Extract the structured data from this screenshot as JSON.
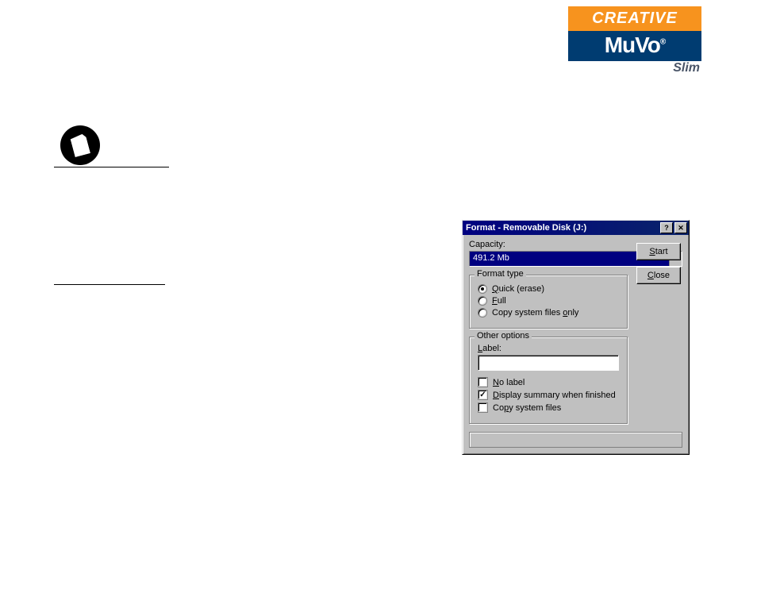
{
  "logo": {
    "line1": "CREATIVE",
    "line2": "MuVo",
    "reg": "®",
    "line3": "Slim"
  },
  "dialog": {
    "title": "Format - Removable Disk (J:)",
    "help_label": "?",
    "close_label": "✕",
    "capacity_label": "Capacity:",
    "capacity_value": "491.2 Mb",
    "start_label": "Start",
    "start_mnemonic": "S",
    "close_btn_label": "Close",
    "close_mnemonic": "C",
    "format_type": {
      "legend": "Format type",
      "options": [
        {
          "label": "Quick (erase)",
          "mnemonic": "Q",
          "checked": true
        },
        {
          "label": "Full",
          "mnemonic": "F",
          "checked": false
        },
        {
          "label": "Copy system files only",
          "mnemonic": "o",
          "checked": false
        }
      ]
    },
    "other": {
      "legend": "Other options",
      "label_text": "Label:",
      "label_mnemonic": "L",
      "label_value": "",
      "checks": [
        {
          "label": "No label",
          "mnemonic": "N",
          "checked": false
        },
        {
          "label": "Display summary when finished",
          "mnemonic": "D",
          "checked": true
        },
        {
          "label": "Copy system files",
          "mnemonic": "p",
          "checked": false
        }
      ]
    }
  }
}
